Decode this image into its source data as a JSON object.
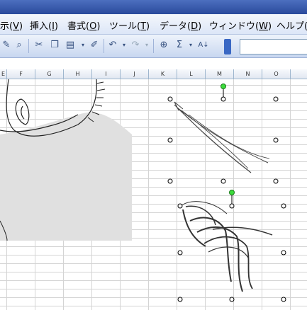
{
  "menu": {
    "items": [
      {
        "label": "示(",
        "key": "V",
        "tail": ")"
      },
      {
        "label": "挿入(",
        "key": "I",
        "tail": ")"
      },
      {
        "label": "書式(",
        "key": "O",
        "tail": ")"
      },
      {
        "label": "ツール(",
        "key": "T",
        "tail": ")"
      },
      {
        "label": "データ(",
        "key": "D",
        "tail": ")"
      },
      {
        "label": "ウィンドウ(",
        "key": "W",
        "tail": ")"
      },
      {
        "label": "ヘルプ(",
        "key": "",
        "tail": ""
      }
    ]
  },
  "toolbar": {
    "icons": [
      "pencil-check-icon",
      "research-icon",
      "cut-icon",
      "copy-icon",
      "paste-icon",
      "format-painter-icon",
      "undo-icon",
      "redo-icon",
      "hyperlink-icon",
      "autosum-icon",
      "sort-icon"
    ],
    "sigma": "Σ",
    "sort_label": "A↓"
  },
  "columns": [
    "E",
    "F",
    "G",
    "H",
    "I",
    "J",
    "K",
    "L",
    "M",
    "N",
    "O"
  ],
  "colors": {
    "titlebar": "#2a4a9c",
    "menubar": "#dce6f7",
    "handle_green": "#3cdc3c",
    "shape_gray": "#e0e0e0"
  }
}
